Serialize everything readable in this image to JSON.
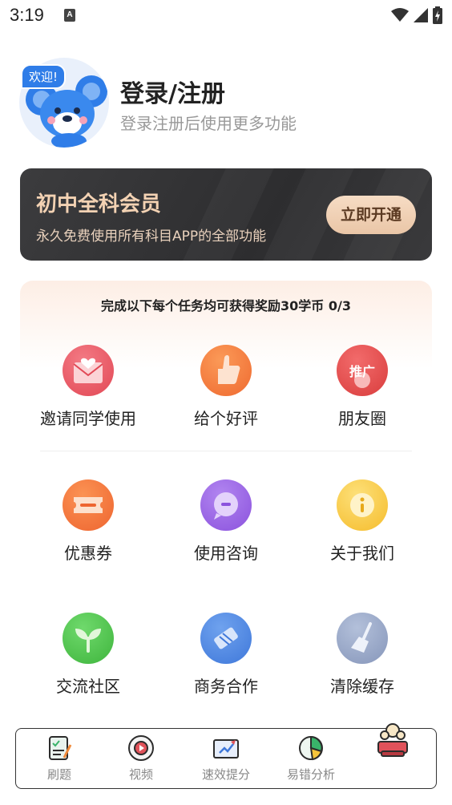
{
  "status_bar": {
    "time": "3:19",
    "notification_letter": "A"
  },
  "profile": {
    "welcome_badge": "欢迎!",
    "title": "登录/注册",
    "subtitle": "登录注册后使用更多功能"
  },
  "membership": {
    "title": "初中全科会员",
    "subtitle": "永久免费使用所有科目APP的全部功能",
    "button": "立即开通"
  },
  "tasks": {
    "header": "完成以下每个任务均可获得奖励30学币 0/3",
    "items": [
      {
        "label": "邀请同学使用",
        "icon": "envelope-heart-icon"
      },
      {
        "label": "给个好评",
        "icon": "thumbs-up-icon"
      },
      {
        "label": "朋友圈",
        "icon": "share-promo-icon",
        "badge": "推广"
      }
    ]
  },
  "tools": {
    "items": [
      {
        "label": "优惠券",
        "icon": "coupon-icon"
      },
      {
        "label": "使用咨询",
        "icon": "chat-bubble-icon"
      },
      {
        "label": "关于我们",
        "icon": "info-icon"
      },
      {
        "label": "交流社区",
        "icon": "sprout-icon"
      },
      {
        "label": "商务合作",
        "icon": "handshake-icon"
      },
      {
        "label": "清除缓存",
        "icon": "broom-icon"
      }
    ]
  },
  "bottom_nav": {
    "items": [
      {
        "label": "刷题",
        "icon": "quiz-sheet-icon"
      },
      {
        "label": "视频",
        "icon": "video-disc-icon"
      },
      {
        "label": "速效提分",
        "icon": "rocket-board-icon"
      },
      {
        "label": "易错分析",
        "icon": "pie-analysis-icon"
      },
      {
        "label": "",
        "icon": "mine-avatar-icon"
      }
    ]
  },
  "colors": {
    "brand_blue": "#2f7de8",
    "member_gold": "#f3d2b3",
    "card_dark": "#2d2d2f",
    "red": "#e8505b",
    "orange": "#f47a3c",
    "purple": "#9a63e0",
    "yellow": "#f7c53b",
    "green": "#4cc04a",
    "blue": "#4a86e0",
    "gray_blue": "#8f9fc2"
  }
}
